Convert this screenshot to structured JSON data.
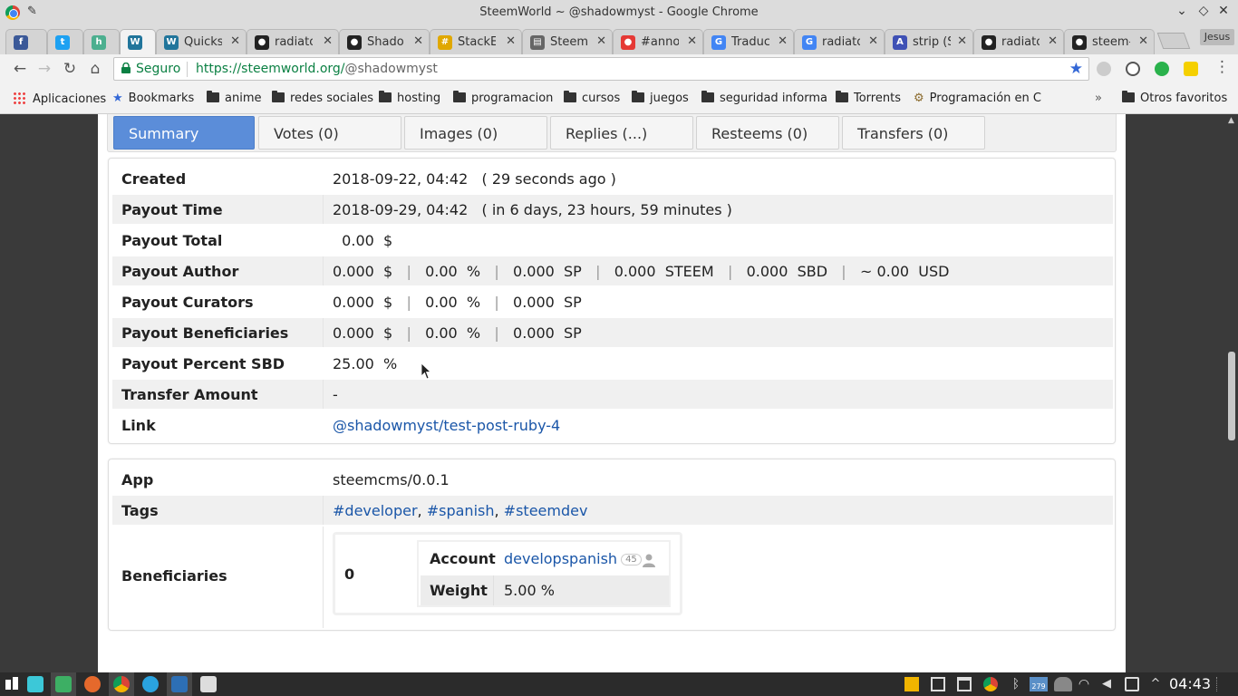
{
  "window": {
    "title": "SteemWorld ~ @shadowmyst - Google Chrome",
    "profile": "Jesus"
  },
  "tabs": [
    {
      "label": "",
      "icon": "facebook-icon",
      "color": "#3b5998"
    },
    {
      "label": "",
      "icon": "twitter-icon",
      "color": "#1da1f2"
    },
    {
      "label": "",
      "icon": "hootsuite-icon",
      "color": "#4caf8f"
    },
    {
      "label": "",
      "icon": "wordpress-icon",
      "color": "#21759b"
    },
    {
      "label": "Quicks",
      "icon": "wordpress-icon",
      "color": "#21759b"
    },
    {
      "label": "radiato",
      "icon": "github-icon",
      "color": "#222222"
    },
    {
      "label": "Shado",
      "icon": "github-icon",
      "color": "#222222"
    },
    {
      "label": "StackE",
      "icon": "stackedit-icon",
      "color": "#e0a800"
    },
    {
      "label": "Steem",
      "icon": "document-icon",
      "color": "#666666"
    },
    {
      "label": "#anno",
      "icon": "record-icon",
      "color": "#e53935"
    },
    {
      "label": "Traduc",
      "icon": "translate-icon",
      "color": "#4285f4"
    },
    {
      "label": "radiato",
      "icon": "google-icon",
      "color": "#4285f4"
    },
    {
      "label": "strip (S",
      "icon": "strip-icon",
      "color": "#3f51b5"
    },
    {
      "label": "radiato",
      "icon": "github-icon",
      "color": "#222222"
    },
    {
      "label": "steem-",
      "icon": "github-icon",
      "color": "#222222"
    }
  ],
  "omnibox": {
    "secure_label": "Seguro",
    "url_host": "https://steemworld.org/",
    "url_path": "@shadowmyst"
  },
  "bookmarks": [
    {
      "label": "Aplicaciones",
      "type": "apps"
    },
    {
      "label": "Bookmarks",
      "type": "star"
    },
    {
      "label": "anime",
      "type": "folder"
    },
    {
      "label": "redes sociales",
      "type": "folder"
    },
    {
      "label": "hosting",
      "type": "folder"
    },
    {
      "label": "programacion",
      "type": "folder"
    },
    {
      "label": "cursos",
      "type": "folder"
    },
    {
      "label": "juegos",
      "type": "folder"
    },
    {
      "label": "seguridad informa",
      "type": "folder"
    },
    {
      "label": "Torrents",
      "type": "folder"
    },
    {
      "label": "Programación en C",
      "type": "page"
    },
    {
      "label": "»",
      "type": "overflow"
    },
    {
      "label": "Otros favoritos",
      "type": "folder"
    }
  ],
  "page_tabs": [
    {
      "label": "Summary",
      "active": true
    },
    {
      "label": "Votes (0)",
      "active": false
    },
    {
      "label": "Images (0)",
      "active": false
    },
    {
      "label": "Replies (...)",
      "active": false
    },
    {
      "label": "Resteems (0)",
      "active": false
    },
    {
      "label": "Transfers (0)",
      "active": false
    }
  ],
  "summary": {
    "created": {
      "label": "Created",
      "date": "2018-09-22, 04:42",
      "ago": "( 29 seconds ago )"
    },
    "payout_time": {
      "label": "Payout Time",
      "date": "2018-09-29, 04:42",
      "in": "( in 6 days, 23 hours, 59 minutes )"
    },
    "payout_total": {
      "label": "Payout Total",
      "value": "0.00",
      "unit": "$"
    },
    "payout_author": {
      "label": "Payout Author",
      "usd": "0.000",
      "pct": "0.00",
      "sp": "0.000",
      "steem": "0.000",
      "sbd": "0.000",
      "approx_usd": "~ 0.00"
    },
    "payout_curators": {
      "label": "Payout Curators",
      "usd": "0.000",
      "pct": "0.00",
      "sp": "0.000"
    },
    "payout_beneficiaries": {
      "label": "Payout Beneficiaries",
      "usd": "0.000",
      "pct": "0.00",
      "sp": "0.000"
    },
    "payout_percent_sbd": {
      "label": "Payout Percent SBD",
      "value": "25.00",
      "unit": "%"
    },
    "transfer_amount": {
      "label": "Transfer Amount",
      "value": "-"
    },
    "link": {
      "label": "Link",
      "value": "@shadowmyst/test-post-ruby-4"
    }
  },
  "units": {
    "usd": "$",
    "pct": "%",
    "sp": "SP",
    "steem": "STEEM",
    "sbd": "SBD",
    "usd_code": "USD",
    "sep": "|"
  },
  "meta": {
    "app": {
      "label": "App",
      "value": "steemcms/0.0.1"
    },
    "tags": {
      "label": "Tags",
      "items": [
        "#developer",
        "#spanish",
        "#steemdev"
      ],
      "comma": ","
    },
    "beneficiaries": {
      "label": "Beneficiaries",
      "index": "0",
      "account_label": "Account",
      "account": "developspanish",
      "reputation": "45",
      "weight_label": "Weight",
      "weight": "5.00 %"
    }
  },
  "taskbar": {
    "clock": "04:43",
    "badge": "279"
  },
  "colors": {
    "accent": "#5b8dd9",
    "link": "#1a56a8",
    "secure": "#0b8043"
  }
}
